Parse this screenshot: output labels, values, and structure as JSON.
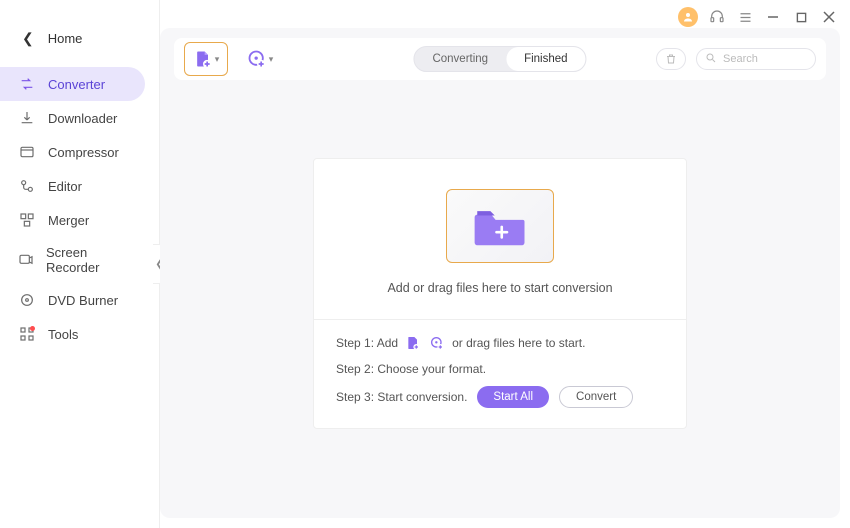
{
  "window": {
    "avatar_color": "#ffc06a"
  },
  "sidebar": {
    "home_label": "Home",
    "items": [
      {
        "label": "Converter",
        "icon": "converter",
        "active": true
      },
      {
        "label": "Downloader",
        "icon": "downloader",
        "active": false
      },
      {
        "label": "Compressor",
        "icon": "compressor",
        "active": false
      },
      {
        "label": "Editor",
        "icon": "editor",
        "active": false
      },
      {
        "label": "Merger",
        "icon": "merger",
        "active": false
      },
      {
        "label": "Screen Recorder",
        "icon": "recorder",
        "active": false
      },
      {
        "label": "DVD Burner",
        "icon": "burner",
        "active": false
      },
      {
        "label": "Tools",
        "icon": "tools",
        "active": false
      }
    ]
  },
  "topbar": {
    "tabs": {
      "converting": "Converting",
      "finished": "Finished",
      "active": "finished"
    },
    "search_placeholder": "Search"
  },
  "drop": {
    "caption": "Add or drag files here to start conversion"
  },
  "steps": {
    "step1_prefix": "Step 1: Add",
    "step1_suffix": "or drag files here to start.",
    "step2": "Step 2: Choose your format.",
    "step3_label": "Step 3: Start conversion.",
    "start_all": "Start All",
    "convert": "Convert"
  }
}
